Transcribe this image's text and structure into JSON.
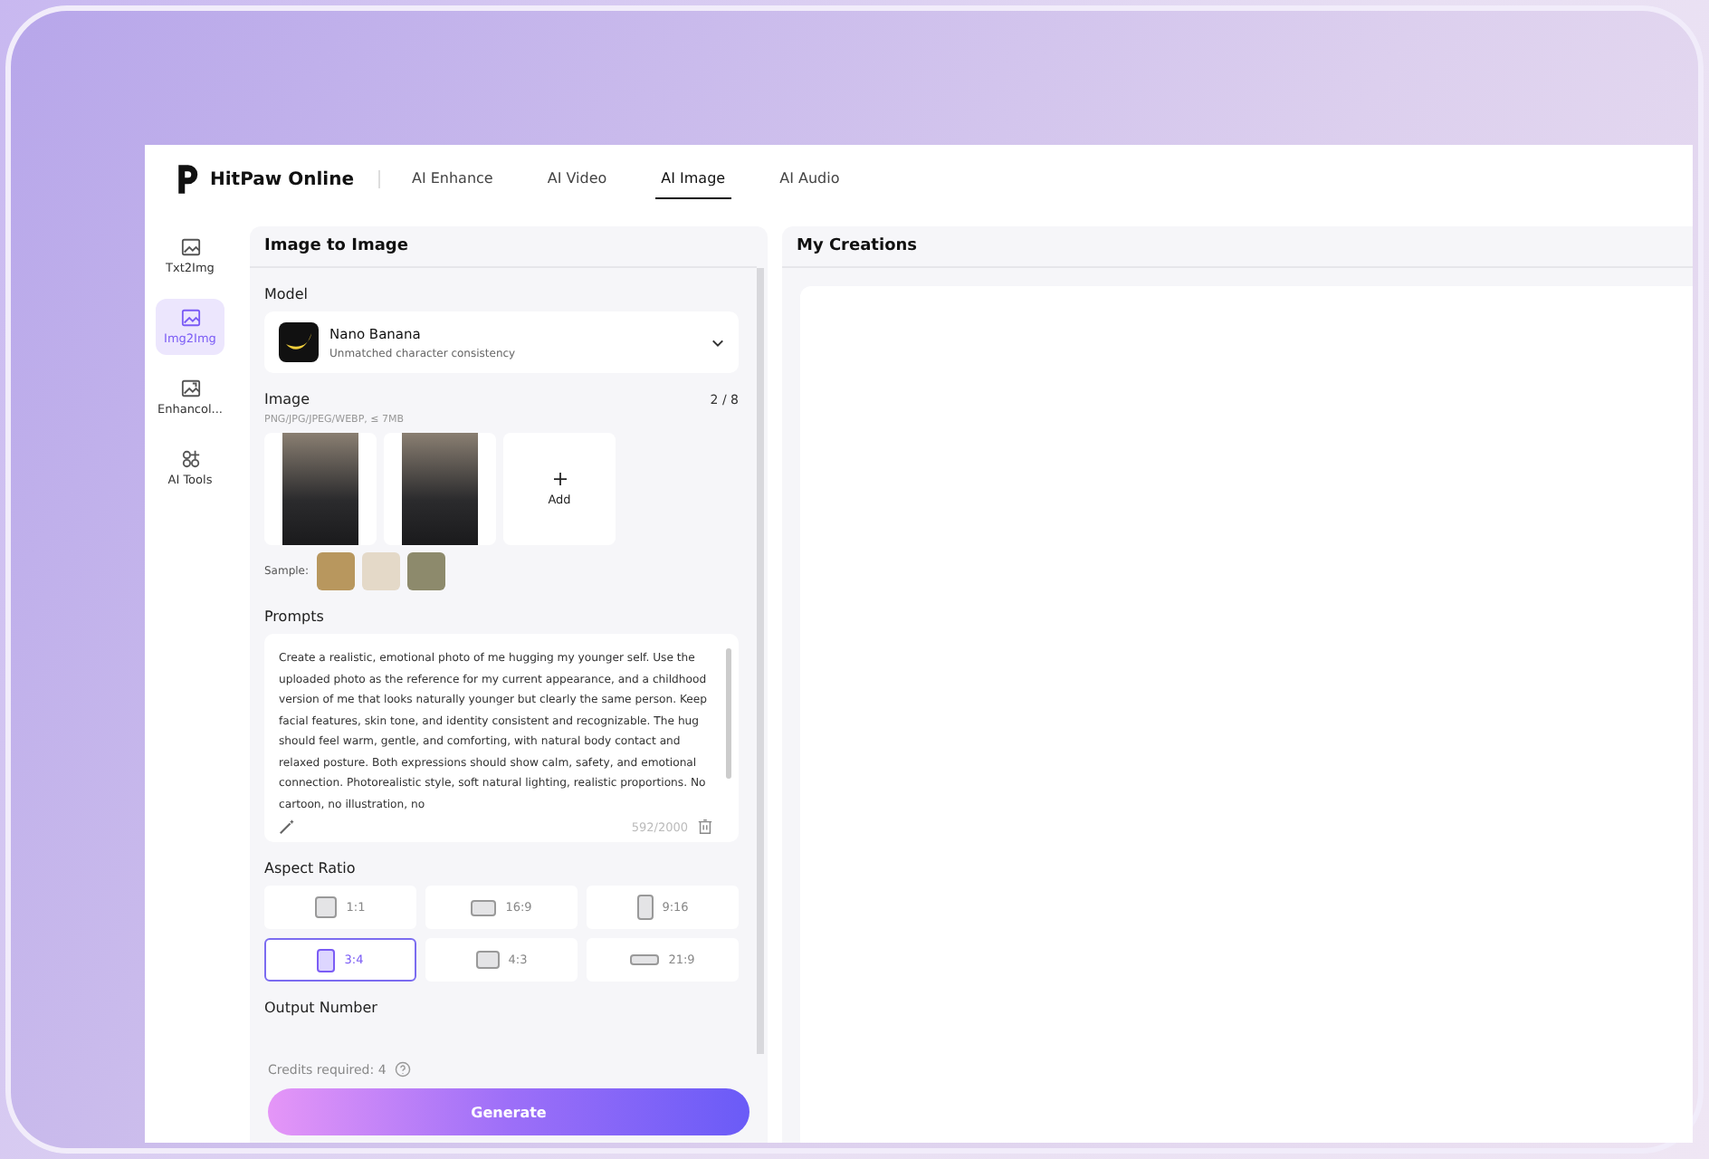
{
  "brand": {
    "name": "HitPaw Online"
  },
  "nav": [
    {
      "label": "AI Enhance",
      "selected": false
    },
    {
      "label": "AI Video",
      "selected": false
    },
    {
      "label": "AI Image",
      "selected": true
    },
    {
      "label": "AI Audio",
      "selected": false
    }
  ],
  "sidebar": {
    "items": [
      {
        "label": "Txt2Img",
        "kind": "text-image",
        "selected": false
      },
      {
        "label": "Img2Img",
        "kind": "image-edit",
        "selected": true
      },
      {
        "label": "Enhancol...",
        "kind": "enhance",
        "selected": false
      },
      {
        "label": "AI Tools",
        "kind": "tools",
        "selected": false
      }
    ]
  },
  "panel": {
    "title": "Image to Image",
    "model": {
      "label": "Model",
      "name": "Nano Banana",
      "description": "Unmatched character consistency"
    },
    "image": {
      "label": "Image",
      "count": "2 / 8",
      "formats": "PNG/JPG/JPEG/WEBP, ≤ 7MB",
      "uploads": [
        {
          "kind": "photo"
        },
        {
          "kind": "photo"
        }
      ],
      "add_label": "Add",
      "sample_label": "Sample:",
      "samples": [
        {
          "color": "#b8975e"
        },
        {
          "color": "#e4d9c8"
        },
        {
          "color": "#8d8a6c"
        }
      ]
    },
    "prompts": {
      "label": "Prompts",
      "value": "Create a realistic, emotional photo of me hugging my younger self. Use the uploaded photo as the reference for my current appearance, and a childhood version of me that looks naturally younger but clearly the same person. Keep facial features, skin tone, and identity consistent and recognizable. The hug should feel warm, gentle, and comforting, with natural body contact and relaxed posture. Both expressions should show calm, safety, and emotional connection. Photorealistic style, soft natural lighting, realistic proportions. No cartoon, no illustration, no",
      "counter": "592/2000"
    },
    "aspect_ratio": {
      "label": "Aspect Ratio",
      "options": [
        {
          "label": "1:1",
          "kind": "square",
          "selected": false
        },
        {
          "label": "16:9",
          "kind": "wide",
          "selected": false
        },
        {
          "label": "9:16",
          "kind": "tall",
          "selected": false
        },
        {
          "label": "3:4",
          "kind": "portrait",
          "selected": true
        },
        {
          "label": "4:3",
          "kind": "landscape",
          "selected": false
        },
        {
          "label": "21:9",
          "kind": "ultrawide",
          "selected": false
        }
      ]
    },
    "output_number": {
      "label": "Output Number"
    },
    "credits": "Credits required: 4",
    "generate": "Generate"
  },
  "creations": {
    "title": "My Creations"
  }
}
